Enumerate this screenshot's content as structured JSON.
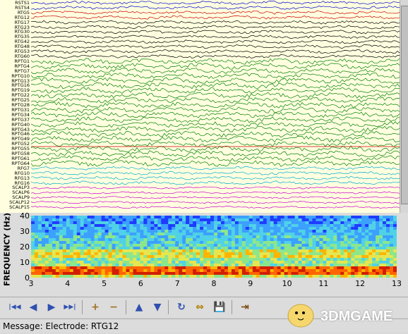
{
  "eeg": {
    "channels": [
      {
        "label": "RSTS1",
        "color": "#0000cc"
      },
      {
        "label": "RSTS4",
        "color": "#0000cc"
      },
      {
        "label": "RTG5",
        "color": "#cc0000"
      },
      {
        "label": "RTG12",
        "color": "#cc0000"
      },
      {
        "label": "RTG17",
        "color": "#000000"
      },
      {
        "label": "RTG23",
        "color": "#000000"
      },
      {
        "label": "RTG30",
        "color": "#000000"
      },
      {
        "label": "RTG35",
        "color": "#000000"
      },
      {
        "label": "RTG42",
        "color": "#000000"
      },
      {
        "label": "RTG48",
        "color": "#000000"
      },
      {
        "label": "RTG53",
        "color": "#000000"
      },
      {
        "label": "RTG60",
        "color": "#000000"
      },
      {
        "label": "RPTG1",
        "color": "#008000"
      },
      {
        "label": "RPTG4",
        "color": "#008000"
      },
      {
        "label": "RPTG7",
        "color": "#008000"
      },
      {
        "label": "RPTG10",
        "color": "#008000"
      },
      {
        "label": "RPTG13",
        "color": "#008000"
      },
      {
        "label": "RPTG16",
        "color": "#008000"
      },
      {
        "label": "RPTG19",
        "color": "#008000"
      },
      {
        "label": "RPTG22",
        "color": "#008000"
      },
      {
        "label": "RPTG25",
        "color": "#008000"
      },
      {
        "label": "RPTG28",
        "color": "#008000"
      },
      {
        "label": "RPTG31",
        "color": "#008000"
      },
      {
        "label": "RPTG34",
        "color": "#008000"
      },
      {
        "label": "RPTG37",
        "color": "#008000"
      },
      {
        "label": "RPTG40",
        "color": "#008000"
      },
      {
        "label": "RPTG43",
        "color": "#008000"
      },
      {
        "label": "RPTG46",
        "color": "#008000"
      },
      {
        "label": "RPTG49",
        "color": "#008000"
      },
      {
        "label": "RPTG52",
        "color": "#008000"
      },
      {
        "label": "RPTG55",
        "color": "#008000"
      },
      {
        "label": "RPTG58",
        "color": "#008000"
      },
      {
        "label": "RPTG61",
        "color": "#008000"
      },
      {
        "label": "RPTG64",
        "color": "#008000"
      },
      {
        "label": "RFG7",
        "color": "#00aacc"
      },
      {
        "label": "RFG10",
        "color": "#00aacc"
      },
      {
        "label": "RFG13",
        "color": "#00aacc"
      },
      {
        "label": "RFG16",
        "color": "#00aacc"
      },
      {
        "label": "SCALP3",
        "color": "#cc00cc"
      },
      {
        "label": "SCALP6",
        "color": "#cc00cc"
      },
      {
        "label": "SCALP9",
        "color": "#cc00cc"
      },
      {
        "label": "SCALP12",
        "color": "#cc00cc"
      },
      {
        "label": "SCALP15",
        "color": "#cc00cc"
      }
    ],
    "marker_color": "#cc0000"
  },
  "spectrogram": {
    "ylabel": "FREQUENCY (Hz)",
    "yticks": [
      "40",
      "30",
      "20",
      "10",
      "0"
    ],
    "xticks": [
      "3",
      "4",
      "5",
      "6",
      "7",
      "8",
      "9",
      "10",
      "11",
      "12",
      "13"
    ]
  },
  "toolbar": {
    "buttons": [
      {
        "name": "first-page-icon",
        "glyph": "|◀◀"
      },
      {
        "name": "previous-page-icon",
        "glyph": "◀"
      },
      {
        "name": "next-page-icon",
        "glyph": "▶"
      },
      {
        "name": "last-page-icon",
        "glyph": "▶▶|"
      },
      {
        "name": "zoom-in-icon",
        "glyph": "+"
      },
      {
        "name": "zoom-out-icon",
        "glyph": "−"
      },
      {
        "name": "increase-gain-icon",
        "glyph": "▲"
      },
      {
        "name": "decrease-gain-icon",
        "glyph": "▼"
      },
      {
        "name": "refresh-icon",
        "glyph": "↻"
      },
      {
        "name": "montage-icon",
        "glyph": "⇔"
      },
      {
        "name": "save-icon",
        "glyph": "💾"
      },
      {
        "name": "export-icon",
        "glyph": "⇥"
      }
    ]
  },
  "status": {
    "message": "Message: Electrode: RTG12"
  },
  "watermark": {
    "text": "3DMGAME"
  }
}
